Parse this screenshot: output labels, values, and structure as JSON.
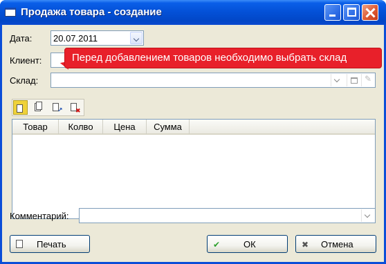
{
  "window": {
    "title": "Продажа товара - создание",
    "icon": "window-icon"
  },
  "form": {
    "date_label": "Дата:",
    "date_value": "20.07.2011",
    "client_label": "Клиент:",
    "client_value": "",
    "warehouse_label": "Склад:",
    "warehouse_value": "",
    "comment_label": "Комментарий:",
    "comment_value": ""
  },
  "tooltip": {
    "text": "Перед добавлением товаров необходимо выбрать склад",
    "color": "#e8202a"
  },
  "toolbar": {
    "items": [
      "add-document-icon",
      "copy-document-icon",
      "edit-document-icon",
      "delete-document-icon"
    ],
    "edit_mark": "↗",
    "delete_mark": "✖"
  },
  "table": {
    "columns": [
      "Товар",
      "Колво",
      "Цена",
      "Сумма"
    ],
    "rows": []
  },
  "buttons": {
    "print": "Печать",
    "ok": "ОК",
    "cancel": "Отмена"
  },
  "icons": {
    "ok": "✔",
    "cancel": "✖"
  },
  "colors": {
    "titlebar": "#0350d6",
    "client_bg": "#ece9d8",
    "close_button": "#de5a32"
  }
}
